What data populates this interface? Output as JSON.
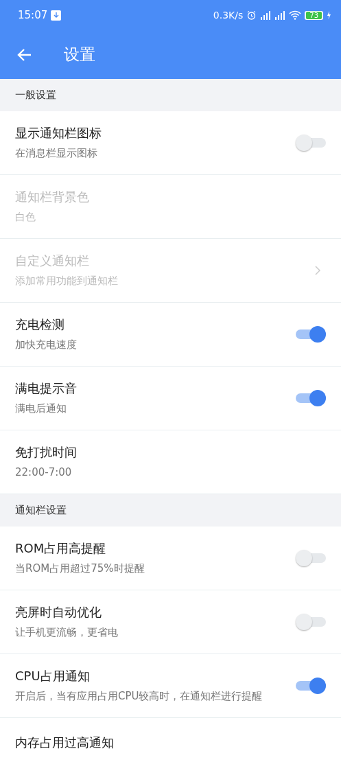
{
  "status_bar": {
    "time": "15:07",
    "speed": "0.3K/s",
    "battery": "73"
  },
  "app_bar": {
    "title": "设置"
  },
  "sections": [
    {
      "header": "一般设置",
      "items": [
        {
          "kind": "toggle",
          "title": "显示通知栏图标",
          "subtitle": "在消息栏显示图标",
          "on": false,
          "disabled": false
        },
        {
          "kind": "plain",
          "title": "通知栏背景色",
          "subtitle": "白色",
          "disabled": true
        },
        {
          "kind": "link",
          "title": "自定义通知栏",
          "subtitle": "添加常用功能到通知栏",
          "disabled": true
        },
        {
          "kind": "toggle",
          "title": "充电检测",
          "subtitle": "加快充电速度",
          "on": true,
          "disabled": false
        },
        {
          "kind": "toggle",
          "title": "满电提示音",
          "subtitle": "满电后通知",
          "on": true,
          "disabled": false
        },
        {
          "kind": "plain",
          "title": "免打扰时间",
          "subtitle": "22:00-7:00",
          "disabled": false
        }
      ]
    },
    {
      "header": "通知栏设置",
      "items": [
        {
          "kind": "toggle",
          "title": "ROM占用高提醒",
          "subtitle": "当ROM占用超过75%时提醒",
          "on": false,
          "disabled": false
        },
        {
          "kind": "toggle",
          "title": "亮屏时自动优化",
          "subtitle": "让手机更流畅，更省电",
          "on": false,
          "disabled": false
        },
        {
          "kind": "toggle",
          "title": "CPU占用通知",
          "subtitle": "开启后，当有应用占用CPU较高时，在通知栏进行提醒",
          "on": true,
          "disabled": false
        },
        {
          "kind": "plain",
          "title": "内存占用过高通知",
          "disabled": false
        }
      ]
    }
  ]
}
